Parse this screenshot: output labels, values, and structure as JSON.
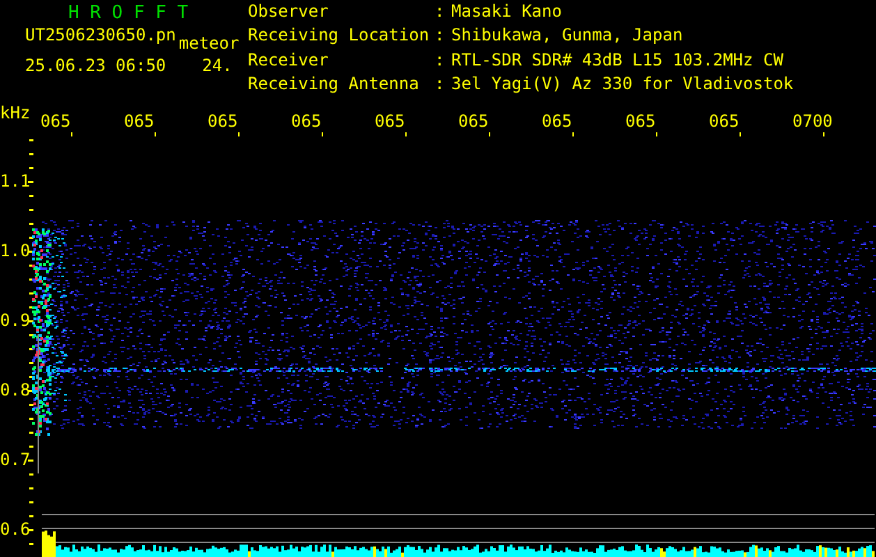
{
  "header": {
    "title": "H R O F F T",
    "filename": "UT2506230650.pn",
    "event_type": "meteor",
    "datetime": "25.06.23 06:50",
    "count": "24.",
    "fields": [
      {
        "label": "Observer",
        "separator": ":",
        "value": "Masaki Kano"
      },
      {
        "label": "Receiving Location",
        "separator": ":",
        "value": "Shibukawa, Gunma, Japan"
      },
      {
        "label": "Receiver",
        "separator": ":",
        "value": "RTL-SDR SDR# 43dB L15 103.2MHz CW"
      },
      {
        "label": "Receiving Antenna",
        "separator": ":",
        "value": "3el Yagi(V) Az 330 for Vladivostok"
      }
    ]
  },
  "y_axis": {
    "unit": "kHz",
    "labels": [
      "1.1",
      "1.0",
      "0.9",
      "0.8",
      "0.7",
      "0.6"
    ]
  },
  "time_labels": [
    "065",
    "065",
    "065",
    "065",
    "065",
    "065",
    "065",
    "065",
    "065",
    "0700"
  ]
}
